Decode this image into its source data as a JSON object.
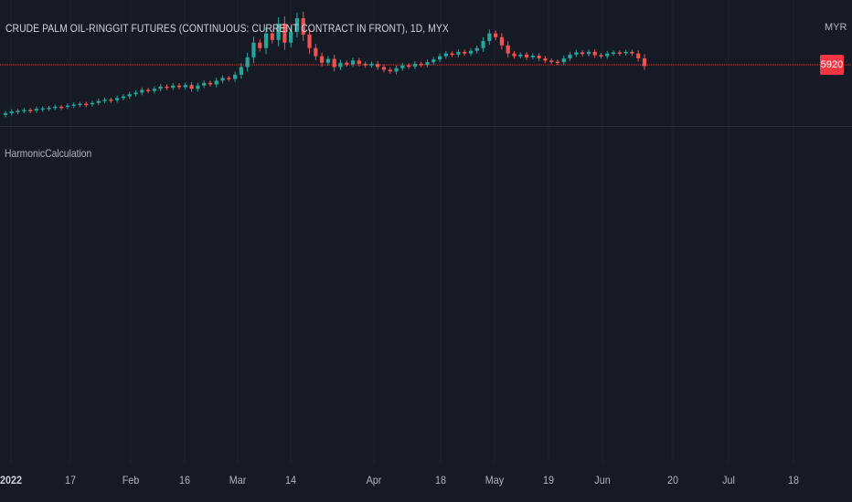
{
  "header": {
    "symbol_title": "CRUDE PALM OIL-RINGGIT FUTURES (CONTINUOUS: CURRENT CONTRACT IN FRONT), 1D, MYX",
    "currency": "MYR"
  },
  "price_axis": {
    "last_price": "5920"
  },
  "indicator": {
    "title": "HarmonicCalculation"
  },
  "colors": {
    "background": "#161a25",
    "up": "#26a69a",
    "down": "#ef5350",
    "grid": "#1f2330",
    "price_line": "#ef5350",
    "badge": "#f23645"
  },
  "time_axis": {
    "labels": [
      "2022",
      "17",
      "Feb",
      "16",
      "Mar",
      "14",
      "Apr",
      "18",
      "May",
      "19",
      "Jun",
      "20",
      "Jul",
      "18"
    ]
  },
  "chart_data": {
    "type": "candlestick",
    "last_price": 5920,
    "candles": [
      {
        "o": 5020,
        "c": 5050
      },
      {
        "o": 5050,
        "c": 5080
      },
      {
        "o": 5080,
        "c": 5095
      },
      {
        "o": 5095,
        "c": 5110
      },
      {
        "o": 5110,
        "c": 5100
      },
      {
        "o": 5100,
        "c": 5130
      },
      {
        "o": 5130,
        "c": 5140
      },
      {
        "o": 5140,
        "c": 5150
      },
      {
        "o": 5150,
        "c": 5170
      },
      {
        "o": 5170,
        "c": 5165
      },
      {
        "o": 5165,
        "c": 5190
      },
      {
        "o": 5190,
        "c": 5210
      },
      {
        "o": 5210,
        "c": 5225
      },
      {
        "o": 5225,
        "c": 5215
      },
      {
        "o": 5215,
        "c": 5240
      },
      {
        "o": 5240,
        "c": 5275
      },
      {
        "o": 5275,
        "c": 5300
      },
      {
        "o": 5300,
        "c": 5290
      },
      {
        "o": 5290,
        "c": 5330
      },
      {
        "o": 5330,
        "c": 5360
      },
      {
        "o": 5360,
        "c": 5400
      },
      {
        "o": 5400,
        "c": 5430
      },
      {
        "o": 5430,
        "c": 5480
      },
      {
        "o": 5480,
        "c": 5460
      },
      {
        "o": 5460,
        "c": 5500
      },
      {
        "o": 5500,
        "c": 5540
      },
      {
        "o": 5540,
        "c": 5520
      },
      {
        "o": 5520,
        "c": 5560
      },
      {
        "o": 5560,
        "c": 5530
      },
      {
        "o": 5530,
        "c": 5570
      },
      {
        "o": 5570,
        "c": 5500
      },
      {
        "o": 5500,
        "c": 5560
      },
      {
        "o": 5560,
        "c": 5610
      },
      {
        "o": 5610,
        "c": 5580
      },
      {
        "o": 5580,
        "c": 5650
      },
      {
        "o": 5650,
        "c": 5700
      },
      {
        "o": 5700,
        "c": 5680
      },
      {
        "o": 5680,
        "c": 5760
      },
      {
        "o": 5760,
        "c": 5900
      },
      {
        "o": 5900,
        "c": 6080
      },
      {
        "o": 6080,
        "c": 6350
      },
      {
        "o": 6350,
        "c": 6250
      },
      {
        "o": 6250,
        "c": 6520
      },
      {
        "o": 6520,
        "c": 6400
      },
      {
        "o": 6400,
        "c": 6700
      },
      {
        "o": 6700,
        "c": 6350
      },
      {
        "o": 6350,
        "c": 6550
      },
      {
        "o": 6550,
        "c": 6800
      },
      {
        "o": 6800,
        "c": 6500
      },
      {
        "o": 6500,
        "c": 6250
      },
      {
        "o": 6250,
        "c": 6100
      },
      {
        "o": 6100,
        "c": 5980
      },
      {
        "o": 5980,
        "c": 6050
      },
      {
        "o": 6050,
        "c": 5900
      },
      {
        "o": 5900,
        "c": 5980
      },
      {
        "o": 5980,
        "c": 5950
      },
      {
        "o": 5950,
        "c": 6020
      },
      {
        "o": 6020,
        "c": 5960
      },
      {
        "o": 5960,
        "c": 5930
      },
      {
        "o": 5930,
        "c": 5960
      },
      {
        "o": 5960,
        "c": 5900
      },
      {
        "o": 5900,
        "c": 5850
      },
      {
        "o": 5850,
        "c": 5820
      },
      {
        "o": 5820,
        "c": 5880
      },
      {
        "o": 5880,
        "c": 5930
      },
      {
        "o": 5930,
        "c": 5910
      },
      {
        "o": 5910,
        "c": 5960
      },
      {
        "o": 5960,
        "c": 5940
      },
      {
        "o": 5940,
        "c": 5990
      },
      {
        "o": 5990,
        "c": 6040
      },
      {
        "o": 6040,
        "c": 6100
      },
      {
        "o": 6100,
        "c": 6150
      },
      {
        "o": 6150,
        "c": 6130
      },
      {
        "o": 6130,
        "c": 6180
      },
      {
        "o": 6180,
        "c": 6150
      },
      {
        "o": 6150,
        "c": 6200
      },
      {
        "o": 6200,
        "c": 6250
      },
      {
        "o": 6250,
        "c": 6380
      },
      {
        "o": 6380,
        "c": 6520
      },
      {
        "o": 6520,
        "c": 6450
      },
      {
        "o": 6450,
        "c": 6300
      },
      {
        "o": 6300,
        "c": 6150
      },
      {
        "o": 6150,
        "c": 6100
      },
      {
        "o": 6100,
        "c": 6130
      },
      {
        "o": 6130,
        "c": 6080
      },
      {
        "o": 6080,
        "c": 6110
      },
      {
        "o": 6110,
        "c": 6060
      },
      {
        "o": 6060,
        "c": 6020
      },
      {
        "o": 6020,
        "c": 6000
      },
      {
        "o": 6000,
        "c": 5990
      },
      {
        "o": 5990,
        "c": 6060
      },
      {
        "o": 6060,
        "c": 6130
      },
      {
        "o": 6130,
        "c": 6170
      },
      {
        "o": 6170,
        "c": 6140
      },
      {
        "o": 6140,
        "c": 6180
      },
      {
        "o": 6180,
        "c": 6120
      },
      {
        "o": 6120,
        "c": 6100
      },
      {
        "o": 6100,
        "c": 6150
      },
      {
        "o": 6150,
        "c": 6170
      },
      {
        "o": 6170,
        "c": 6160
      },
      {
        "o": 6160,
        "c": 6180
      },
      {
        "o": 6180,
        "c": 6150
      },
      {
        "o": 6150,
        "c": 6060
      },
      {
        "o": 6060,
        "c": 5920
      }
    ]
  }
}
